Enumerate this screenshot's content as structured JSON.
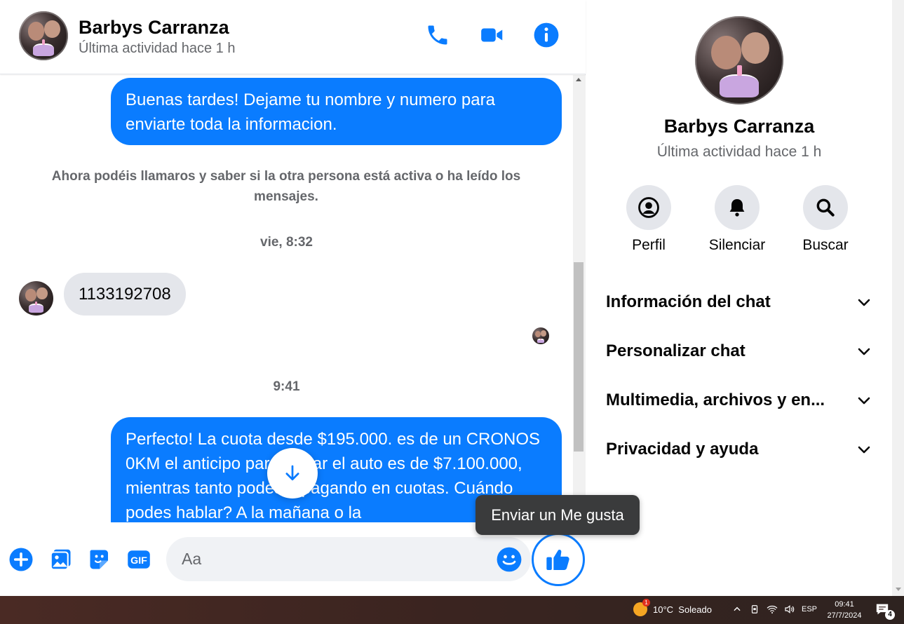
{
  "header": {
    "name": "Barbys Carranza",
    "status": "Última actividad hace 1 h"
  },
  "messages": {
    "outgoing_1": "Buenas tardes! Dejame tu nombre y numero para enviarte toda la informacion.",
    "system_note": "Ahora podéis llamaros y saber si la otra persona está activa o ha leído los mensajes.",
    "timestamp_1": "vie, 8:32",
    "incoming_1": "1133192708",
    "timestamp_2": "9:41",
    "outgoing_2": "Perfecto! La cuota desde $195.000. es de un CRONOS 0KM el anticipo para retirar el auto es de $7.100.000, mientras tanto podes ir pagando en cuotas. Cuándo podes hablar? A la mañana o la"
  },
  "composer": {
    "placeholder": "Aa",
    "tooltip": "Enviar un Me gusta"
  },
  "side": {
    "name": "Barbys Carranza",
    "status": "Última actividad hace 1 h",
    "actions": [
      "Perfil",
      "Silenciar",
      "Buscar"
    ],
    "sections": [
      "Información del chat",
      "Personalizar chat",
      "Multimedia, archivos y en...",
      "Privacidad y ayuda"
    ]
  },
  "taskbar": {
    "weather": "10°C  Soleado",
    "weather_badge": "1",
    "language": "ESP",
    "time": "09:41",
    "date": "27/7/2024",
    "notification_count": "4"
  },
  "colors": {
    "accent": "#0a7cff",
    "incoming_bubble": "#e4e6eb",
    "secondary_text": "#65676b"
  }
}
